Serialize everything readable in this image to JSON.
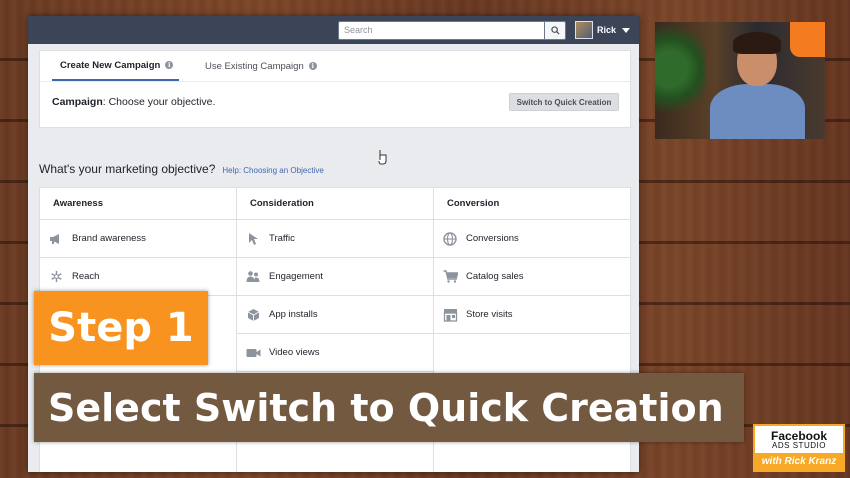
{
  "topbar": {
    "search_placeholder": "Search",
    "profile_name": "Rick"
  },
  "campaign": {
    "tabs": [
      {
        "label": "Create New Campaign",
        "active": true
      },
      {
        "label": "Use Existing Campaign",
        "active": false
      }
    ],
    "heading_bold": "Campaign",
    "heading_rest": ": Choose your objective.",
    "switch_button": "Switch to Quick Creation"
  },
  "objective": {
    "title": "What's your marketing objective?",
    "help_link": "Help: Choosing an Objective",
    "columns": [
      {
        "header": "Awareness",
        "items": [
          {
            "label": "Brand awareness",
            "icon": "megaphone-icon"
          },
          {
            "label": "Reach",
            "icon": "asterisk-icon"
          }
        ]
      },
      {
        "header": "Consideration",
        "items": [
          {
            "label": "Traffic",
            "icon": "cursor-icon"
          },
          {
            "label": "Engagement",
            "icon": "people-icon"
          },
          {
            "label": "App installs",
            "icon": "box-icon"
          },
          {
            "label": "Video views",
            "icon": "video-camera-icon"
          }
        ]
      },
      {
        "header": "Conversion",
        "items": [
          {
            "label": "Conversions",
            "icon": "globe-icon"
          },
          {
            "label": "Catalog sales",
            "icon": "cart-icon"
          },
          {
            "label": "Store visits",
            "icon": "store-icon"
          }
        ]
      }
    ]
  },
  "overlay": {
    "step_label": "Step 1",
    "caption": "Select Switch to Quick Creation"
  },
  "branding": {
    "line1": "Facebook",
    "line2": "ADS STUDIO",
    "line3": "with Rick Kranz"
  },
  "colors": {
    "facebook_blue": "#4267b2",
    "topbar": "#3b4557",
    "step_badge": "#f7931e",
    "caption_banner": "#735940",
    "logo_orange": "#f7a826"
  }
}
